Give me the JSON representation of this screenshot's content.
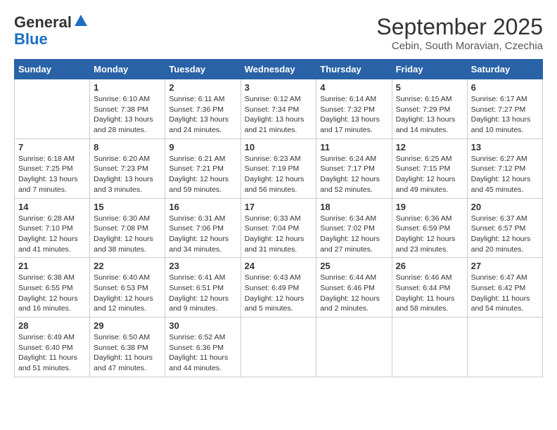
{
  "logo": {
    "general": "General",
    "blue": "Blue"
  },
  "title": "September 2025",
  "location": "Cebin, South Moravian, Czechia",
  "weekdays": [
    "Sunday",
    "Monday",
    "Tuesday",
    "Wednesday",
    "Thursday",
    "Friday",
    "Saturday"
  ],
  "weeks": [
    [
      {
        "day": "",
        "info": ""
      },
      {
        "day": "1",
        "info": "Sunrise: 6:10 AM\nSunset: 7:38 PM\nDaylight: 13 hours and 28 minutes."
      },
      {
        "day": "2",
        "info": "Sunrise: 6:11 AM\nSunset: 7:36 PM\nDaylight: 13 hours and 24 minutes."
      },
      {
        "day": "3",
        "info": "Sunrise: 6:12 AM\nSunset: 7:34 PM\nDaylight: 13 hours and 21 minutes."
      },
      {
        "day": "4",
        "info": "Sunrise: 6:14 AM\nSunset: 7:32 PM\nDaylight: 13 hours and 17 minutes."
      },
      {
        "day": "5",
        "info": "Sunrise: 6:15 AM\nSunset: 7:29 PM\nDaylight: 13 hours and 14 minutes."
      },
      {
        "day": "6",
        "info": "Sunrise: 6:17 AM\nSunset: 7:27 PM\nDaylight: 13 hours and 10 minutes."
      }
    ],
    [
      {
        "day": "7",
        "info": "Sunrise: 6:18 AM\nSunset: 7:25 PM\nDaylight: 13 hours and 7 minutes."
      },
      {
        "day": "8",
        "info": "Sunrise: 6:20 AM\nSunset: 7:23 PM\nDaylight: 13 hours and 3 minutes."
      },
      {
        "day": "9",
        "info": "Sunrise: 6:21 AM\nSunset: 7:21 PM\nDaylight: 12 hours and 59 minutes."
      },
      {
        "day": "10",
        "info": "Sunrise: 6:23 AM\nSunset: 7:19 PM\nDaylight: 12 hours and 56 minutes."
      },
      {
        "day": "11",
        "info": "Sunrise: 6:24 AM\nSunset: 7:17 PM\nDaylight: 12 hours and 52 minutes."
      },
      {
        "day": "12",
        "info": "Sunrise: 6:25 AM\nSunset: 7:15 PM\nDaylight: 12 hours and 49 minutes."
      },
      {
        "day": "13",
        "info": "Sunrise: 6:27 AM\nSunset: 7:12 PM\nDaylight: 12 hours and 45 minutes."
      }
    ],
    [
      {
        "day": "14",
        "info": "Sunrise: 6:28 AM\nSunset: 7:10 PM\nDaylight: 12 hours and 41 minutes."
      },
      {
        "day": "15",
        "info": "Sunrise: 6:30 AM\nSunset: 7:08 PM\nDaylight: 12 hours and 38 minutes."
      },
      {
        "day": "16",
        "info": "Sunrise: 6:31 AM\nSunset: 7:06 PM\nDaylight: 12 hours and 34 minutes."
      },
      {
        "day": "17",
        "info": "Sunrise: 6:33 AM\nSunset: 7:04 PM\nDaylight: 12 hours and 31 minutes."
      },
      {
        "day": "18",
        "info": "Sunrise: 6:34 AM\nSunset: 7:02 PM\nDaylight: 12 hours and 27 minutes."
      },
      {
        "day": "19",
        "info": "Sunrise: 6:36 AM\nSunset: 6:59 PM\nDaylight: 12 hours and 23 minutes."
      },
      {
        "day": "20",
        "info": "Sunrise: 6:37 AM\nSunset: 6:57 PM\nDaylight: 12 hours and 20 minutes."
      }
    ],
    [
      {
        "day": "21",
        "info": "Sunrise: 6:38 AM\nSunset: 6:55 PM\nDaylight: 12 hours and 16 minutes."
      },
      {
        "day": "22",
        "info": "Sunrise: 6:40 AM\nSunset: 6:53 PM\nDaylight: 12 hours and 12 minutes."
      },
      {
        "day": "23",
        "info": "Sunrise: 6:41 AM\nSunset: 6:51 PM\nDaylight: 12 hours and 9 minutes."
      },
      {
        "day": "24",
        "info": "Sunrise: 6:43 AM\nSunset: 6:49 PM\nDaylight: 12 hours and 5 minutes."
      },
      {
        "day": "25",
        "info": "Sunrise: 6:44 AM\nSunset: 6:46 PM\nDaylight: 12 hours and 2 minutes."
      },
      {
        "day": "26",
        "info": "Sunrise: 6:46 AM\nSunset: 6:44 PM\nDaylight: 11 hours and 58 minutes."
      },
      {
        "day": "27",
        "info": "Sunrise: 6:47 AM\nSunset: 6:42 PM\nDaylight: 11 hours and 54 minutes."
      }
    ],
    [
      {
        "day": "28",
        "info": "Sunrise: 6:49 AM\nSunset: 6:40 PM\nDaylight: 11 hours and 51 minutes."
      },
      {
        "day": "29",
        "info": "Sunrise: 6:50 AM\nSunset: 6:38 PM\nDaylight: 11 hours and 47 minutes."
      },
      {
        "day": "30",
        "info": "Sunrise: 6:52 AM\nSunset: 6:36 PM\nDaylight: 11 hours and 44 minutes."
      },
      {
        "day": "",
        "info": ""
      },
      {
        "day": "",
        "info": ""
      },
      {
        "day": "",
        "info": ""
      },
      {
        "day": "",
        "info": ""
      }
    ]
  ]
}
